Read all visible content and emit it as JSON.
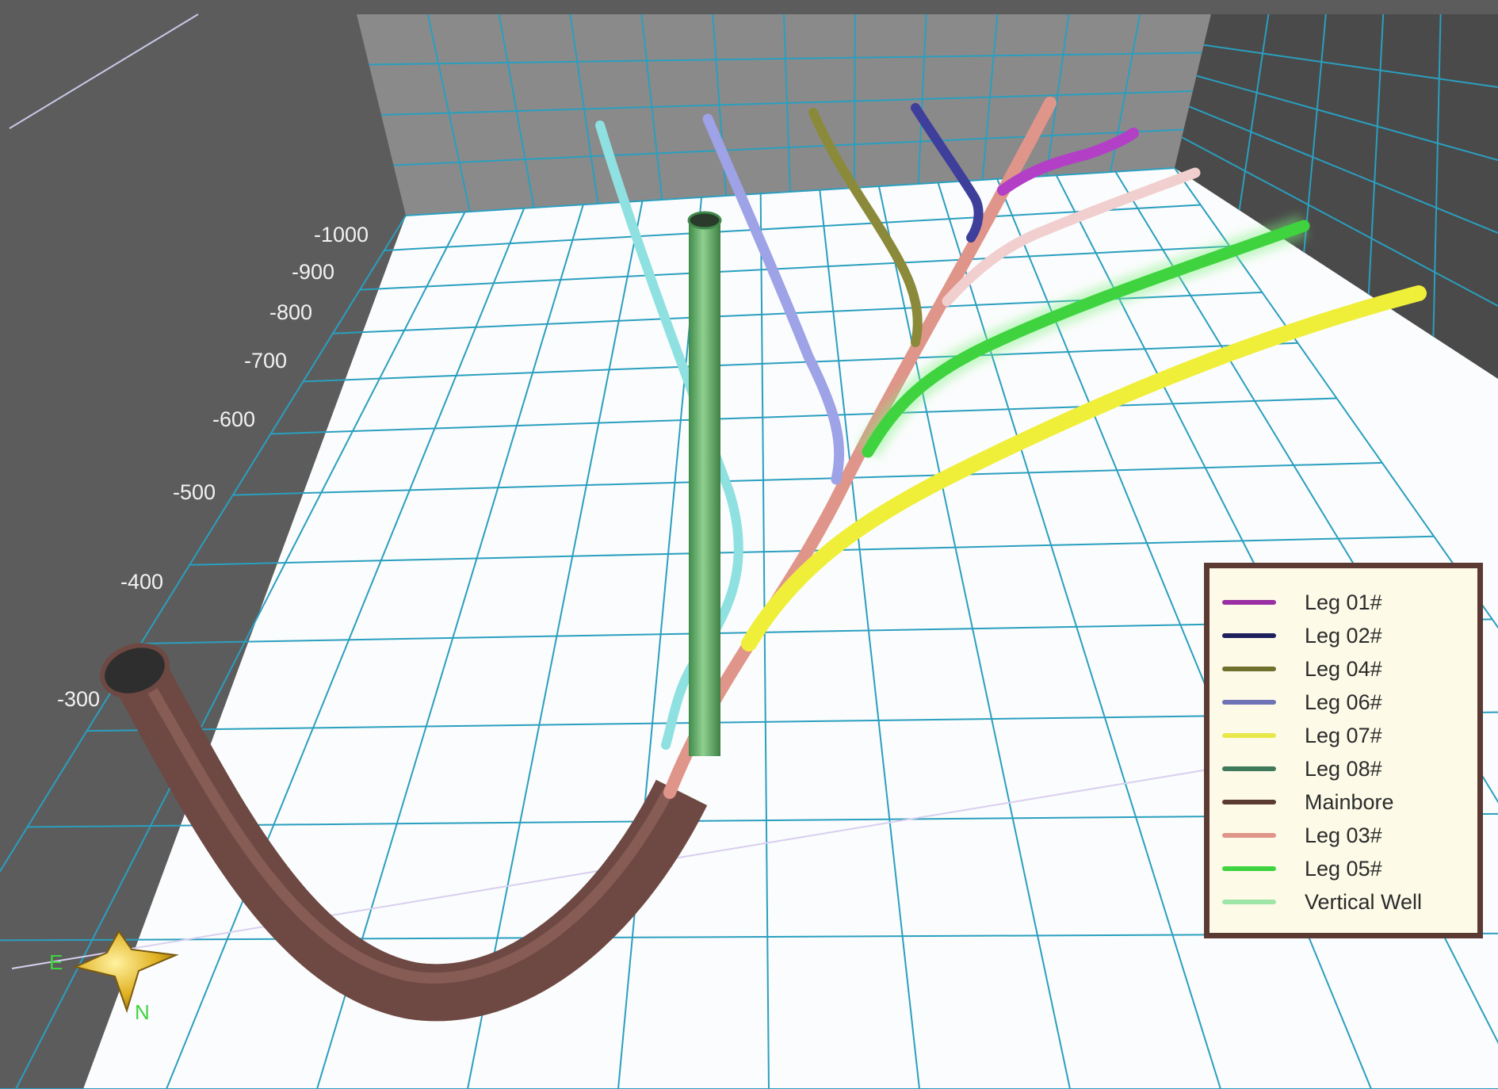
{
  "z_axis": {
    "ticks": [
      "-1000",
      "-900",
      "-800",
      "-700",
      "-600",
      "-500",
      "-400",
      "-300"
    ]
  },
  "compass": {
    "east": "E",
    "north": "N"
  },
  "colors": {
    "wall": "#5c5c5c",
    "grid": "#2a9fbf",
    "floor": "#fbfcfd"
  },
  "legend": {
    "items": [
      {
        "label": "Leg 01#",
        "color": "#9a2fa4"
      },
      {
        "label": "Leg 02#",
        "color": "#1f1f5e"
      },
      {
        "label": "Leg 04#",
        "color": "#6f6f2e"
      },
      {
        "label": "Leg 06#",
        "color": "#6e73b6"
      },
      {
        "label": "Leg 07#",
        "color": "#e8e84a"
      },
      {
        "label": "Leg 08#",
        "color": "#3f7a5a"
      },
      {
        "label": "Mainbore",
        "color": "#5a3a33"
      },
      {
        "label": "Leg 03#",
        "color": "#e0958a"
      },
      {
        "label": "Leg 05#",
        "color": "#3fd43f"
      },
      {
        "label": "Vertical Well",
        "color": "#9ee6a8"
      }
    ]
  }
}
